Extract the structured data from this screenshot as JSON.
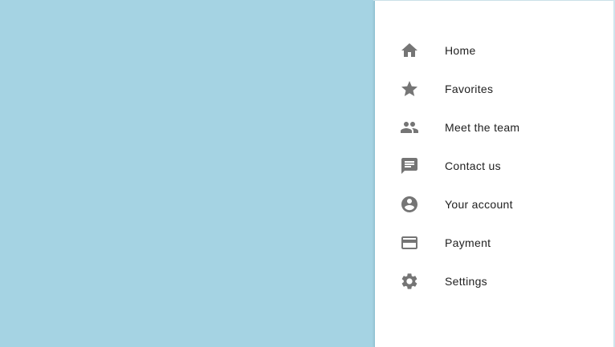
{
  "menu": {
    "items": [
      {
        "label": "Home",
        "icon": "home-icon"
      },
      {
        "label": "Favorites",
        "icon": "star-icon"
      },
      {
        "label": "Meet the team",
        "icon": "people-icon"
      },
      {
        "label": "Contact us",
        "icon": "chat-icon"
      },
      {
        "label": "Your account",
        "icon": "account-circle-icon"
      },
      {
        "label": "Payment",
        "icon": "credit-card-icon"
      },
      {
        "label": "Settings",
        "icon": "gear-icon"
      }
    ]
  },
  "colors": {
    "scrim": "#a5d3e3",
    "drawer": "#ffffff",
    "icon": "#757575",
    "text": "#212121"
  }
}
